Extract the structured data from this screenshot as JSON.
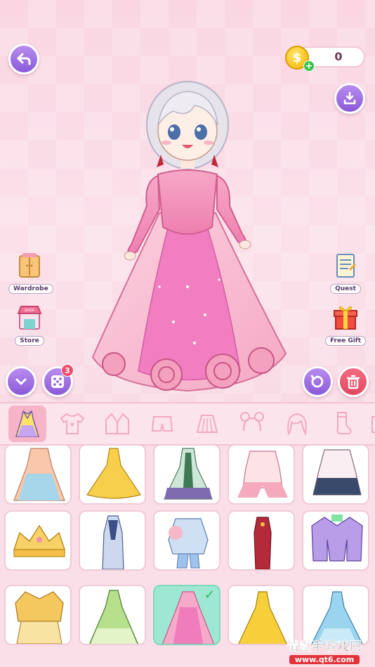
{
  "hud": {
    "coins": "0",
    "back_icon": "arrow-left-icon",
    "download_icon": "download-icon"
  },
  "left_menu": {
    "wardrobe_label": "Wardrobe",
    "store_label": "Store",
    "random_badge": "3"
  },
  "right_menu": {
    "quest_label": "Quest",
    "free_gift_label": "Free Gift"
  },
  "categories": [
    "dress",
    "top",
    "jacket",
    "skirt",
    "pleated-skirt",
    "hair-bun",
    "hair",
    "socks",
    "shoes"
  ],
  "watermark": {
    "title": "蜻蜓手游戏网",
    "url": "www.qt6.com"
  },
  "colors": {
    "accent_purple": "#9b6be0",
    "accent_red": "#e9556c",
    "background_pink": "#fbdde6"
  }
}
